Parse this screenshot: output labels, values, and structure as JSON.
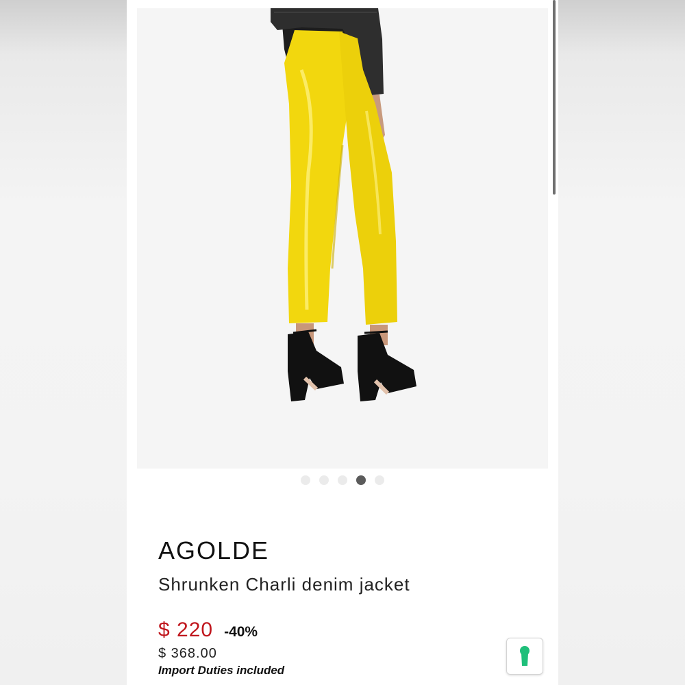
{
  "gallery": {
    "dots": [
      {
        "active": false
      },
      {
        "active": false
      },
      {
        "active": false
      },
      {
        "active": true
      },
      {
        "active": false
      }
    ]
  },
  "product": {
    "brand": "AGOLDE",
    "name": "Shrunken Charli denim jacket",
    "sale_price": "$ 220",
    "discount": "-40%",
    "original_price": "$ 368.00",
    "duties_note": "Import Duties included"
  },
  "colors": {
    "sale_price": "#c0161d",
    "pants": "#f2d70e",
    "jacket": "#2b2b2b",
    "app_icon": "#1fbf7a"
  },
  "icons": {
    "image": "model-yellow-pants-photo",
    "app": "keyhole-icon"
  }
}
